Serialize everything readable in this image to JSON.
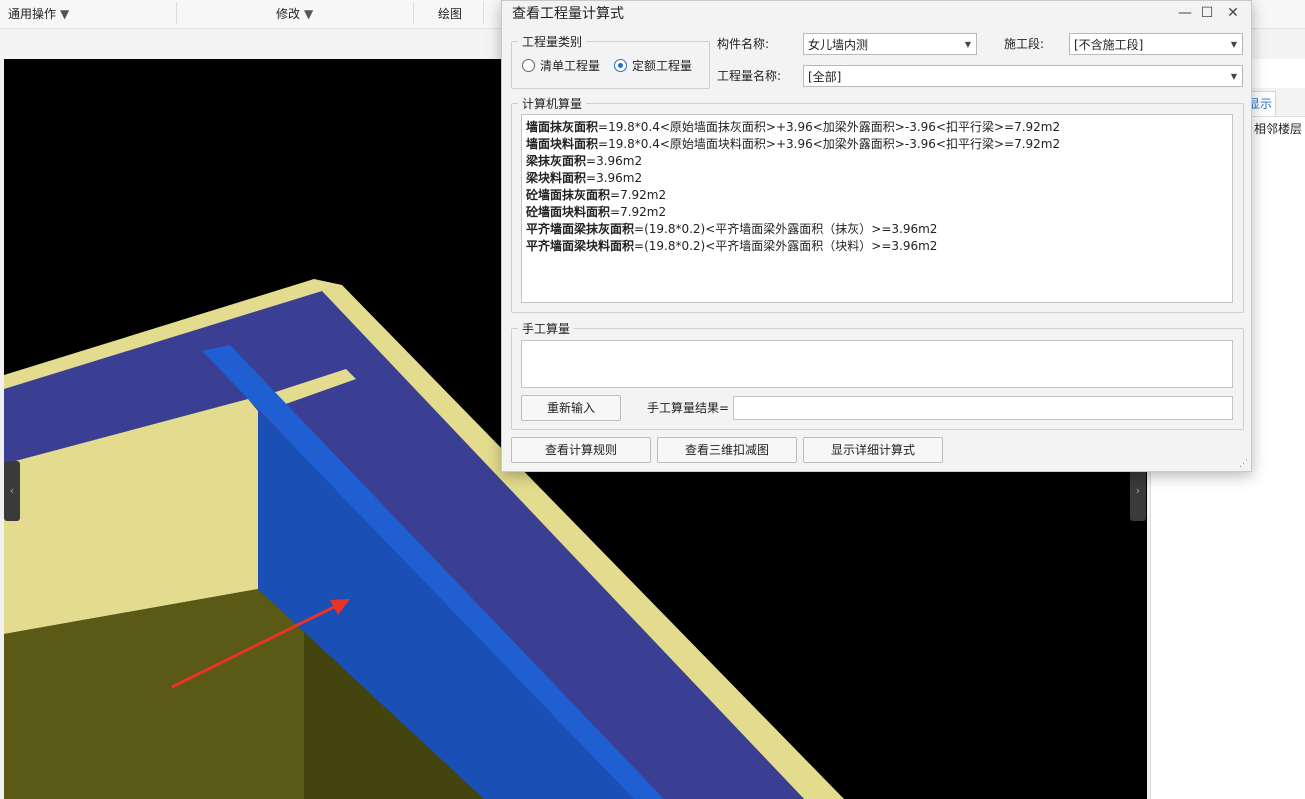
{
  "toolbar": {
    "general_ops": "通用操作",
    "modify": "修改",
    "draw": "绘图"
  },
  "right_panel": {
    "tab_label": "显示",
    "adjacent_floor": "相邻楼层"
  },
  "dialog": {
    "title": "查看工程量计算式",
    "category_group_label": "工程量类别",
    "radio_bill": "清单工程量",
    "radio_quota": "定额工程量",
    "selected_category": "定额工程量",
    "component_label": "构件名称:",
    "component_value": "女儿墙内测",
    "stage_label": "施工段:",
    "stage_value": "[不含施工段]",
    "quantity_name_label": "工程量名称:",
    "quantity_name_value": "[全部]",
    "computer_group_label": "计算机算量",
    "calc_lines": [
      {
        "name": "墙面抹灰面积",
        "formula": "=19.8*0.4<原始墙面抹灰面积>+3.96<加梁外露面积>-3.96<扣平行梁>=7.92m2"
      },
      {
        "name": "墙面块料面积",
        "formula": "=19.8*0.4<原始墙面块料面积>+3.96<加梁外露面积>-3.96<扣平行梁>=7.92m2"
      },
      {
        "name": "梁抹灰面积",
        "formula": "=3.96m2"
      },
      {
        "name": "梁块料面积",
        "formula": "=3.96m2"
      },
      {
        "name": "砼墙面抹灰面积",
        "formula": "=7.92m2"
      },
      {
        "name": "砼墙面块料面积",
        "formula": "=7.92m2"
      },
      {
        "name": "平齐墙面梁抹灰面积",
        "formula": "=(19.8*0.2)<平齐墙面梁外露面积（抹灰）>=3.96m2"
      },
      {
        "name": "平齐墙面梁块料面积",
        "formula": "=(19.8*0.2)<平齐墙面梁外露面积（块料）>=3.96m2"
      }
    ],
    "manual_group_label": "手工算量",
    "reenter_button": "重新输入",
    "manual_result_label": "手工算量结果=",
    "manual_result_value": "",
    "view_rules_button": "查看计算规则",
    "view_3d_button": "查看三维扣减图",
    "show_detail_button": "显示详细计算式"
  },
  "colors": {
    "wall_yellow": "#e3dc8e",
    "wall_inner": "#5a5a16",
    "slab_top": "#3a3f93",
    "beam_blue": "#1a4fb5",
    "arrow_red": "#e8332a",
    "accent": "#1f6fd1"
  }
}
